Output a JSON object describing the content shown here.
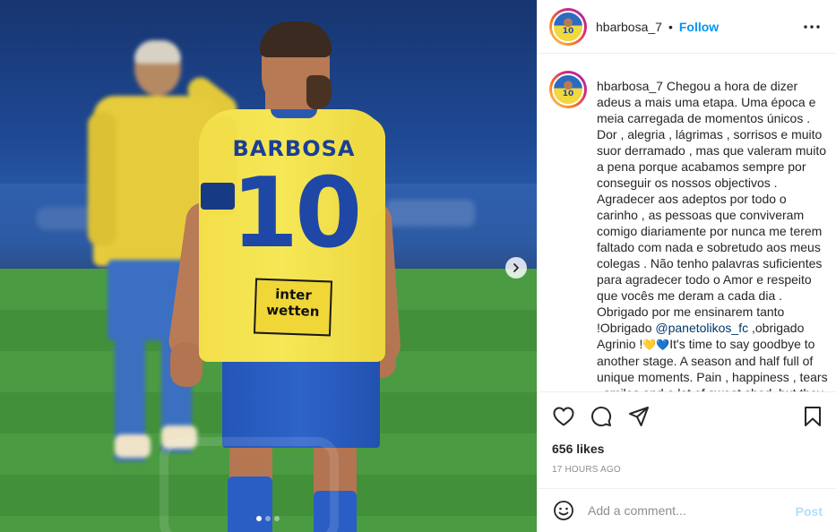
{
  "post": {
    "image_alt": "",
    "carousel": {
      "total": 3,
      "current": 1
    }
  },
  "jersey": {
    "name": "BARBOSA",
    "number": "10",
    "sponsor_line1": "inter",
    "sponsor_line2": "wetten"
  },
  "header": {
    "username": "hbarbosa_7",
    "separator": "•",
    "follow_label": "Follow"
  },
  "caption": {
    "username": "hbarbosa_7",
    "text_part1": " Chegou a hora de dizer adeus a mais uma etapa. Uma época e meia carregada de momentos únicos . Dor , alegria , lágrimas , sorrisos e muito suor derramado , mas que valeram muito a pena porque acabamos sempre por conseguir os nossos objectivos . Agradecer aos adeptos por todo o carinho , as pessoas que conviveram comigo diariamente por nunca me terem faltado com nada e sobretudo aos meus colegas . Não tenho palavras suficientes para agradecer todo o Amor e respeito que vocês me deram a cada dia . Obrigado por me ensinarem tanto !Obrigado ",
    "mention": "@panetolikos_fc",
    "text_part2": " ,obrigado Agrinio !",
    "emoji": "💛💙",
    "text_part3": "It's time to say goodbye to another stage. A season and half full of unique moments. Pain , happiness , tears , smiles and a lot of sweat shed, but they were very worth it because we always managed to achieve our goals."
  },
  "actions": {
    "like_icon": "heart-icon",
    "comment_icon": "comment-icon",
    "share_icon": "paper-plane-icon",
    "save_icon": "bookmark-icon"
  },
  "likes_text": "656 likes",
  "time_text": "17 HOURS AGO",
  "comment": {
    "placeholder": "Add a comment...",
    "post_label": "Post"
  },
  "colors": {
    "accent": "#0095f6",
    "post_disabled": "#b2dffc",
    "mention": "#00376b",
    "muted": "#8e8e8e"
  }
}
